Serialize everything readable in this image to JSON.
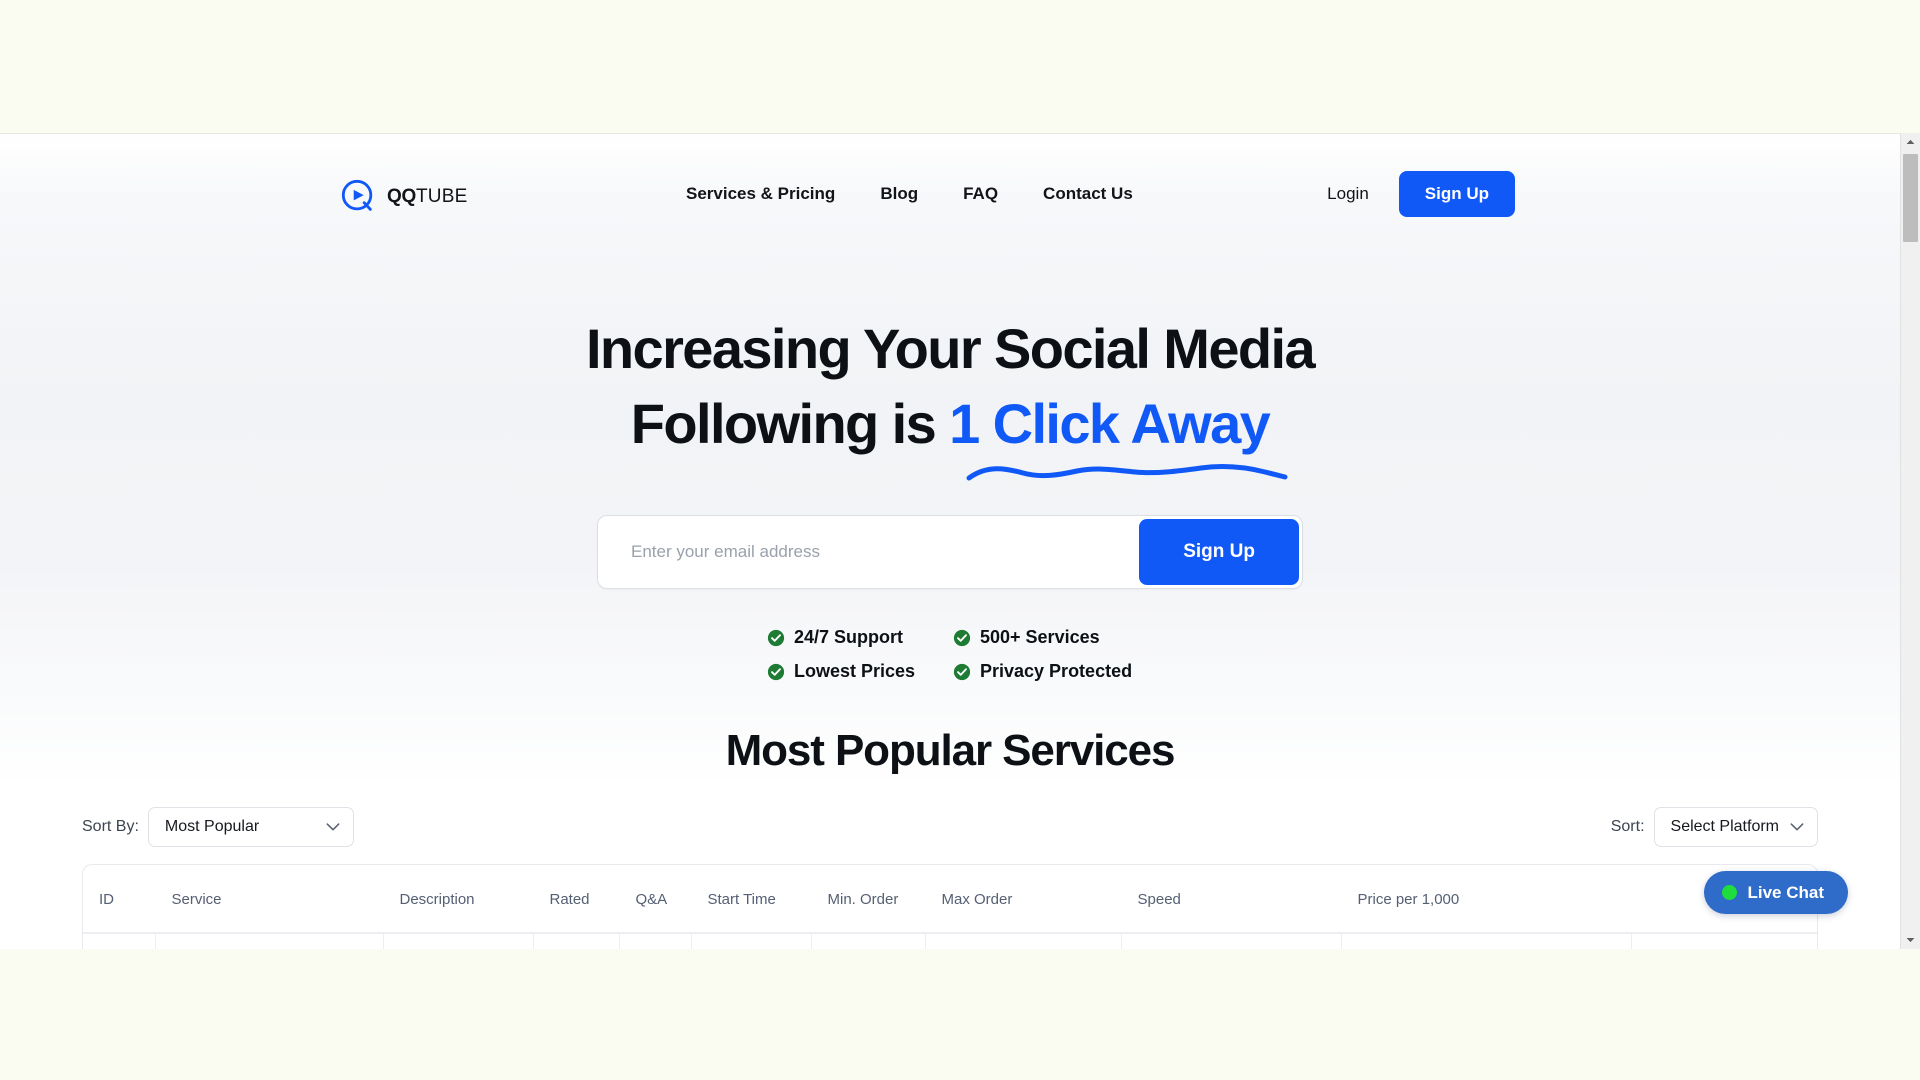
{
  "theme": {
    "accent_blue": "#1159F7",
    "chat_blue": "#2F6BC9",
    "check_green": "#1E7B34",
    "dot_green": "#1FDD3C",
    "text_dark": "#0D1116",
    "text_muted": "#555F73",
    "page_band": "#FAFCF2"
  },
  "header": {
    "logo": {
      "icon": "play-circle-icon",
      "text_bold": "QQ",
      "text_light": "TUBE"
    },
    "nav": [
      {
        "label": "Services & Pricing"
      },
      {
        "label": "Blog"
      },
      {
        "label": "FAQ"
      },
      {
        "label": "Contact Us"
      }
    ],
    "login_label": "Login",
    "signup_label": "Sign Up"
  },
  "hero": {
    "title_line1": "Increasing Your Social Media",
    "title_line2_prefix": "Following is ",
    "title_line2_accent": "1 Click Away",
    "email_placeholder": "Enter your email address",
    "email_value": "",
    "signup_button": "Sign Up",
    "features": [
      {
        "label": "24/7 Support",
        "icon": "check-circle-icon"
      },
      {
        "label": "500+ Services",
        "icon": "check-circle-icon"
      },
      {
        "label": "Lowest Prices",
        "icon": "check-circle-icon"
      },
      {
        "label": "Privacy Protected",
        "icon": "check-circle-icon"
      }
    ]
  },
  "services_section": {
    "title": "Most Popular Services",
    "sort_by_label": "Sort By:",
    "sort_by_value": "Most Popular",
    "platform_label": "Sort:",
    "platform_value": "Select Platform",
    "columns": [
      "ID",
      "Service",
      "Description",
      "Rated",
      "Q&A",
      "Start Time",
      "Min. Order",
      "Max Order",
      "Speed",
      "Price per 1,000"
    ]
  },
  "live_chat": {
    "label": "Live Chat",
    "status_icon": "green-dot-icon"
  },
  "scrollbar": {
    "up_icon": "scroll-up-arrow-icon",
    "down_icon": "scroll-down-arrow-icon"
  }
}
